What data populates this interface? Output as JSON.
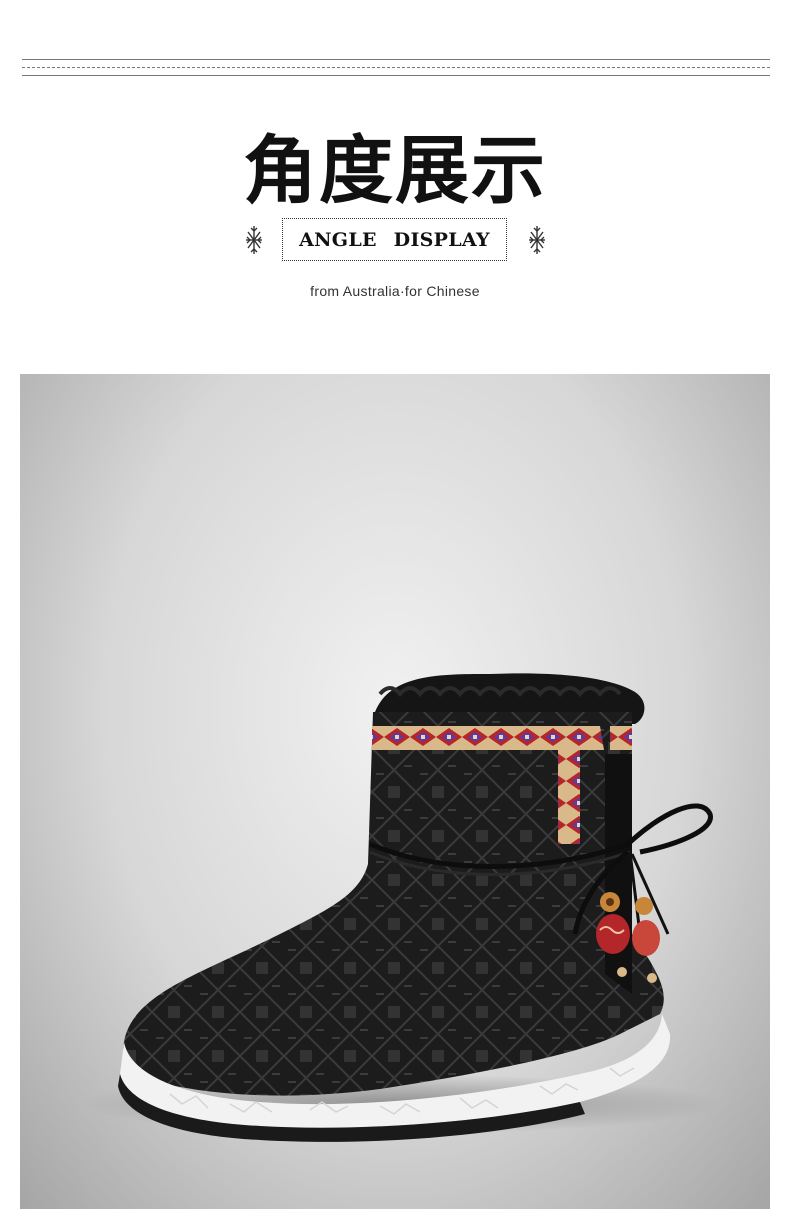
{
  "header": {
    "title": "角度展示",
    "subtitle": "ANGLE DISPLAY",
    "tagline": "from Australia·for Chinese"
  },
  "icons": {
    "left": "snowflake-icon",
    "right": "snowflake-icon"
  },
  "photo": {
    "subject": "black ankle snow boot with ethnic embroidered trim, leather lace tie with wooden beads, white foam sole",
    "colors": {
      "background": "#d9d9d9",
      "boot": "#1a1a1a",
      "sole": "#f2f2f2",
      "trim_red": "#b3262a",
      "trim_purple": "#5a3aa8"
    }
  }
}
